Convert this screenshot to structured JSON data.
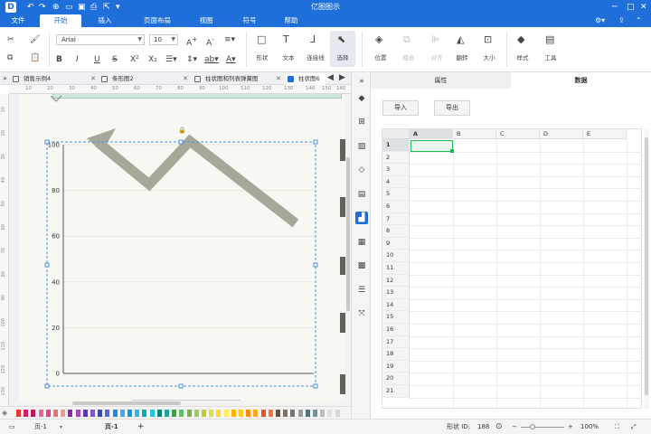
{
  "app": {
    "title": "亿图图示",
    "logo_glyph": "D",
    "brand_color": "#1e6fd9"
  },
  "menu": [
    {
      "label": "文件"
    },
    {
      "label": "开始"
    },
    {
      "label": "插入"
    },
    {
      "label": "页面布局"
    },
    {
      "label": "视图"
    },
    {
      "label": "符号"
    },
    {
      "label": "帮助"
    }
  ],
  "ribbon": {
    "font_name": "Arial",
    "font_size": "10",
    "shape_label": "形状",
    "text_label": "文本",
    "connector_label": "连接线",
    "select_label": "选择",
    "position_label": "位置",
    "group_label": "组合",
    "align_label": "对齐",
    "flip_label": "翻转",
    "size_label": "大小",
    "style_label": "样式",
    "tools_label": "工具"
  },
  "tabs": [
    {
      "label": "销售示例4"
    },
    {
      "label": "条形图2"
    },
    {
      "label": "柱状图和列表弹簧图"
    },
    {
      "label": "柱状图6"
    }
  ],
  "ruler_h": [
    "10",
    "20",
    "30",
    "40",
    "50",
    "60",
    "70",
    "80",
    "90",
    "100",
    "110",
    "120",
    "130",
    "140",
    "150",
    "160"
  ],
  "ruler_v": [
    "10",
    "20",
    "30",
    "40",
    "50",
    "60",
    "70",
    "80",
    "90",
    "100",
    "110",
    "120",
    "130"
  ],
  "chart_data": {
    "type": "bar",
    "categories": [],
    "values": [],
    "yticks": [
      "100",
      "80",
      "60",
      "40",
      "20",
      "0"
    ],
    "ylim": [
      0,
      100
    ],
    "arrow_color": "#a7a79a",
    "gridlines": true
  },
  "right_panel": {
    "tab_properties": "属性",
    "tab_data": "数据",
    "import_button": "导入",
    "export_button": "导出",
    "columns": [
      "A",
      "B",
      "C",
      "D",
      "E"
    ],
    "rows": [
      "1",
      "2",
      "3",
      "4",
      "5",
      "6",
      "7",
      "8",
      "9",
      "10",
      "11",
      "12",
      "13",
      "14",
      "15",
      "16",
      "17",
      "18",
      "19",
      "20",
      "21"
    ],
    "selected_cell": "A1"
  },
  "status": {
    "page_label": "页-1",
    "active_page": "页-1",
    "add_page": "+",
    "shape_id_label": "形状 ID:",
    "shape_id": "188",
    "zoom": "100%"
  },
  "palette_colors": [
    "#e53935",
    "#d81b60",
    "#c2185b",
    "#f06292",
    "#ec407a",
    "#e57373",
    "#ef9a9a",
    "#8e24aa",
    "#ab47bc",
    "#5e35b1",
    "#7e57c2",
    "#3949ab",
    "#5c6bc0",
    "#1e88e5",
    "#42a5f5",
    "#039be5",
    "#29b6f6",
    "#00acc1",
    "#26c6da",
    "#00897b",
    "#26a69a",
    "#43a047",
    "#66bb6a",
    "#7cb342",
    "#9ccc65",
    "#c0ca33",
    "#d4e157",
    "#fdd835",
    "#ffee58",
    "#ffb300",
    "#ffca28",
    "#fb8c00",
    "#ffa726",
    "#f4511e",
    "#ff7043",
    "#6d4c41",
    "#8d6e63",
    "#757575",
    "#9e9e9e",
    "#546e7a",
    "#78909c",
    "#bdbdbd",
    "#e0e0e0",
    "#cfd8dc"
  ]
}
